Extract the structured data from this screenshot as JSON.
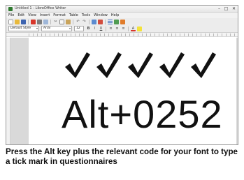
{
  "window": {
    "title": "Untitled 1 - LibreOffice Writer",
    "controls": {
      "minimize": "–",
      "maximize": "□",
      "close": "✕"
    }
  },
  "menubar": {
    "items": [
      "File",
      "Edit",
      "View",
      "Insert",
      "Format",
      "Table",
      "Tools",
      "Window",
      "Help"
    ]
  },
  "toolbar": {
    "icons": [
      "new-icon",
      "open-icon",
      "save-icon",
      "export-pdf-icon",
      "print-icon",
      "print-preview-icon",
      "cut-icon",
      "copy-icon",
      "paste-icon",
      "undo-icon",
      "redo-icon",
      "find-icon",
      "spellcheck-icon",
      "table-icon",
      "image-icon",
      "chart-icon"
    ]
  },
  "formatting": {
    "paragraph_style": "Default Style",
    "font_name": "Arial",
    "font_size": "12"
  },
  "document": {
    "checkmarks": [
      "✓",
      "✓",
      "✓",
      "✓",
      "✓"
    ],
    "alt_code": "Alt+0252"
  },
  "caption": "Press the Alt key plus the relevant code for your font to type a tick mark in questionnaires",
  "colors": {
    "text": "#111111",
    "page": "#ffffff",
    "workspace": "#d9d9d9",
    "chrome": "#ececec"
  }
}
